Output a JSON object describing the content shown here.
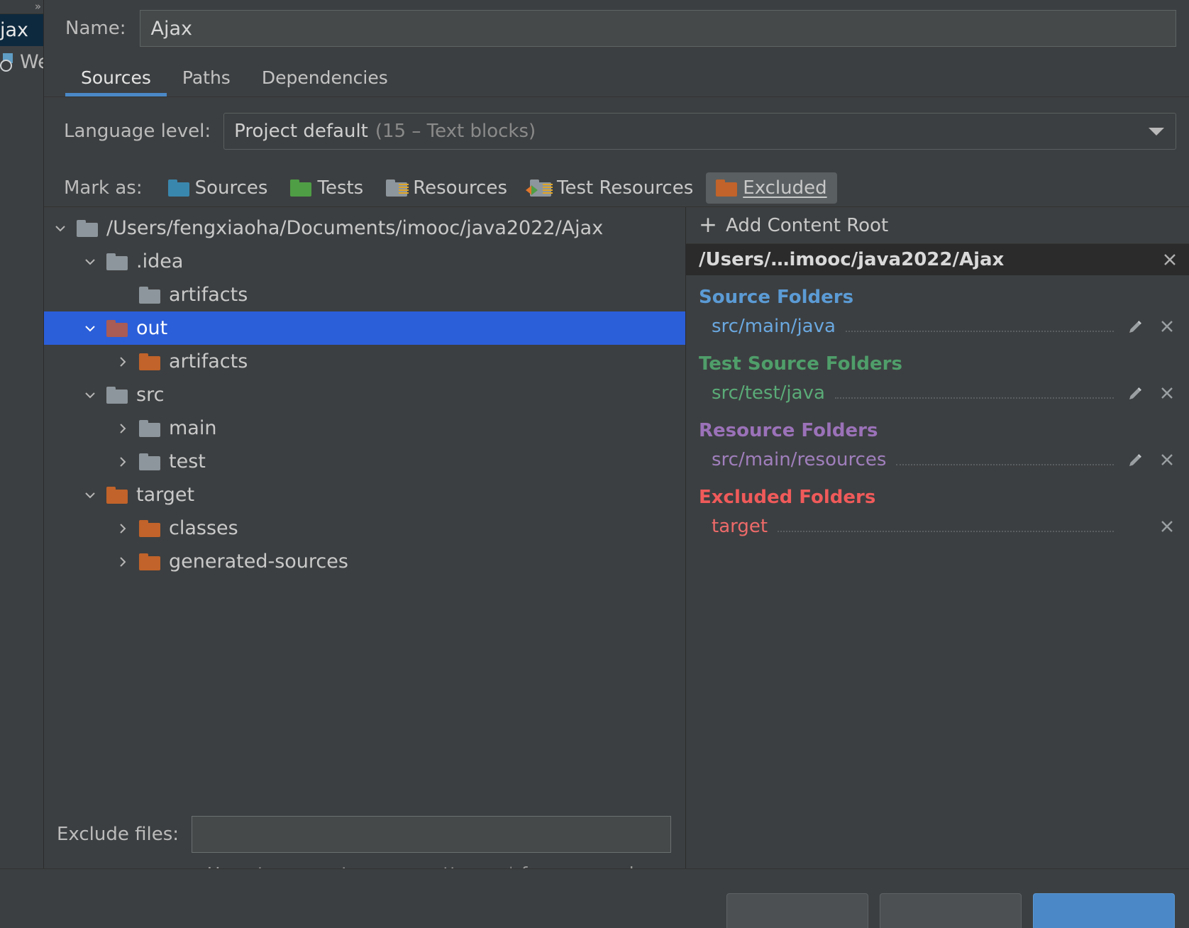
{
  "left_strip": {
    "expand_icon": "chevron-double-right-icon",
    "items": [
      {
        "label": "jax",
        "selected": true,
        "icon": "module-icon"
      },
      {
        "label": "We",
        "selected": false,
        "icon": "web-facet-icon"
      }
    ]
  },
  "name_field": {
    "label": "Name:",
    "value": "Ajax",
    "placeholder": ""
  },
  "tabs": [
    {
      "label": "Sources",
      "active": true
    },
    {
      "label": "Paths",
      "active": false
    },
    {
      "label": "Dependencies",
      "active": false
    }
  ],
  "language_level": {
    "label": "Language level:",
    "value": "Project default",
    "detail": "(15 – Text blocks)",
    "dropdown_icon": "chevron-down-icon"
  },
  "mark_as": {
    "label": "Mark as:",
    "buttons": [
      {
        "label": "Sources",
        "mnemonic": "S",
        "folder": "blue",
        "pressed": false,
        "overlay": "none"
      },
      {
        "label": "Tests",
        "mnemonic": "T",
        "folder": "green",
        "pressed": false,
        "overlay": "none"
      },
      {
        "label": "Resources",
        "mnemonic": "R",
        "folder": "grey",
        "pressed": false,
        "overlay": "lines"
      },
      {
        "label": "Test Resources",
        "mnemonic": "",
        "folder": "grey",
        "pressed": false,
        "overlay": "both"
      },
      {
        "label": "Excluded",
        "mnemonic": "E",
        "folder": "orange",
        "pressed": true,
        "overlay": "none"
      }
    ]
  },
  "tree": [
    {
      "label": "/Users/fengxiaoha/Documents/imooc/java2022/Ajax",
      "depth": 0,
      "twist": "down",
      "folder": "grey",
      "selected": false
    },
    {
      "label": ".idea",
      "depth": 1,
      "twist": "down",
      "folder": "grey",
      "selected": false
    },
    {
      "label": "artifacts",
      "depth": 2,
      "twist": "none",
      "folder": "grey",
      "selected": false
    },
    {
      "label": "out",
      "depth": 1,
      "twist": "down",
      "folder": "dullred",
      "selected": true
    },
    {
      "label": "artifacts",
      "depth": 2,
      "twist": "right",
      "folder": "orange",
      "selected": false
    },
    {
      "label": "src",
      "depth": 1,
      "twist": "down",
      "folder": "grey",
      "selected": false
    },
    {
      "label": "main",
      "depth": 2,
      "twist": "right",
      "folder": "grey",
      "selected": false
    },
    {
      "label": "test",
      "depth": 2,
      "twist": "right",
      "folder": "grey",
      "selected": false
    },
    {
      "label": "target",
      "depth": 1,
      "twist": "down",
      "folder": "orange",
      "selected": false
    },
    {
      "label": "classes",
      "depth": 2,
      "twist": "right",
      "folder": "orange",
      "selected": false
    },
    {
      "label": "generated-sources",
      "depth": 2,
      "twist": "right",
      "folder": "orange",
      "selected": false
    }
  ],
  "exclude_files": {
    "label": "Exclude files:",
    "value": "",
    "placeholder": "",
    "hint": "Use ; to separate name patterns, * for any number of symbols, ? for one."
  },
  "right_pane": {
    "add_content_root": {
      "label": "Add Content Root",
      "mnemonic": "C",
      "plus_icon": "plus-icon"
    },
    "content_root": {
      "path": "/Users/…imooc/java2022/Ajax",
      "remove_icon": "close-icon"
    },
    "groups": [
      {
        "title": "Source Folders",
        "color": "#5b9bd5",
        "title_class": "c-source",
        "row_class": "c-source-l",
        "rows": [
          {
            "path": "src/main/java",
            "edit": true,
            "remove": true
          }
        ]
      },
      {
        "title": "Test Source Folders",
        "color": "#4f9e6a",
        "title_class": "c-test",
        "row_class": "c-test-l",
        "rows": [
          {
            "path": "src/test/java",
            "edit": true,
            "remove": true
          }
        ]
      },
      {
        "title": "Resource Folders",
        "color": "#9b72b9",
        "title_class": "c-res",
        "row_class": "c-res-l",
        "rows": [
          {
            "path": "src/main/resources",
            "edit": true,
            "remove": true
          }
        ]
      },
      {
        "title": "Excluded Folders",
        "color": "#f05a5a",
        "title_class": "c-excl",
        "row_class": "c-excl-l",
        "rows": [
          {
            "path": "target",
            "edit": false,
            "remove": true
          }
        ]
      }
    ],
    "edit_icon": "pencil-icon",
    "remove_icon": "close-icon"
  },
  "colors": {
    "background": "#3c3f41",
    "selection_blue": "#2b5ed9",
    "tab_underline": "#4a88c7",
    "source_blue": "#5b9bd5",
    "test_green": "#4f9e6a",
    "resource_purple": "#9b72b9",
    "excluded_red": "#f05a5a",
    "folder_orange": "#c1632a"
  }
}
